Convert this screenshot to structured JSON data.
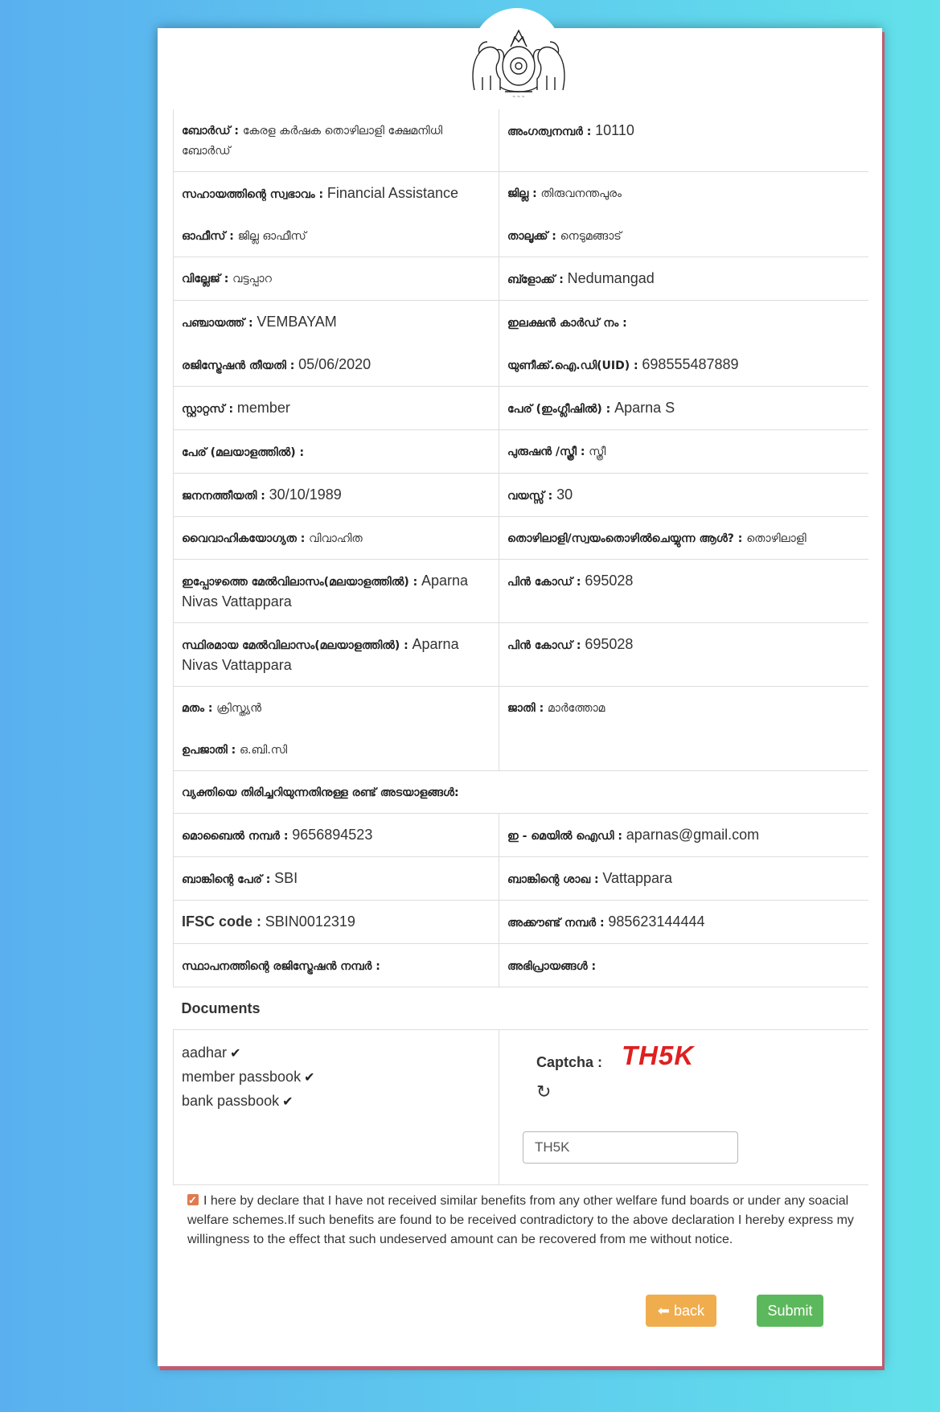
{
  "emblem": "kerala-state-emblem",
  "rows": [
    [
      {
        "label": "ബോർഡ് :",
        "value": "കേരള കർഷക തൊഴിലാളി ക്ഷേമനിധി ബോർഡ്",
        "style": "ml"
      },
      {
        "label": "അംഗത്വനമ്പർ :",
        "value": "10110",
        "style": "en"
      }
    ],
    [
      {
        "label": "സഹായത്തിന്റെ സ്വഭാവം :",
        "value": "Financial Assistance",
        "style": "en"
      },
      {
        "label": "ജില്ല :",
        "value": "തിരുവനന്തപുരം",
        "style": "ml"
      }
    ],
    [
      {
        "label": "ഓഫീസ് :",
        "value": "ജില്ല ഓഫീസ്",
        "style": "ml"
      },
      {
        "label": "താലൂക്ക് :",
        "value": "നെടുമങ്ങാട്",
        "style": "ml"
      }
    ],
    [
      {
        "label": "വില്ലേജ് :",
        "value": "വട്ടപ്പാറ",
        "style": "ml"
      },
      {
        "label": "ബ്ളോക്ക് :",
        "value": "Nedumangad",
        "style": "en"
      }
    ],
    [
      {
        "label": "പഞ്ചായത്ത് :",
        "value": "VEMBAYAM",
        "style": "en"
      },
      {
        "label": "ഇലക്ഷൻ കാർഡ് നം :",
        "value": "",
        "style": "en"
      }
    ],
    [
      {
        "label": "രജിസ്ട്രേഷൻ തീയതി :",
        "value": "05/06/2020",
        "style": "en"
      },
      {
        "label": "യുണീക്ക്.ഐ.ഡി(UID) :",
        "value": "698555487889",
        "style": "en"
      }
    ],
    [
      {
        "label": "സ്റ്റാറ്റസ് :",
        "value": "member",
        "style": "en"
      },
      {
        "label": "പേര് (ഇംഗ്ലീഷിൽ) :",
        "value": "Aparna S",
        "style": "en"
      }
    ],
    [
      {
        "label": "പേര് (മലയാളത്തിൽ) :",
        "value": "",
        "style": "en"
      },
      {
        "label": "പുരുഷൻ /സ്ത്രീ :",
        "value": "സ്ത്രീ",
        "style": "ml"
      }
    ],
    [
      {
        "label": "ജനനത്തീയതി :",
        "value": "30/10/1989",
        "style": "en"
      },
      {
        "label": "വയസ്സ് :",
        "value": "30",
        "style": "en"
      }
    ],
    [
      {
        "label": "വൈവാഹികയോഗ്യത :",
        "value": "വിവാഹിത",
        "style": "ml"
      },
      {
        "label": "തൊഴിലാളി/സ്വയംതൊഴിൽചെയ്യുന്ന ആൾ? :",
        "value": "തൊഴിലാളി",
        "style": "ml"
      }
    ],
    [
      {
        "label": "ഇപ്പോഴത്തെ മേൽവിലാസം(മലയാളത്തിൽ) :",
        "value": "Aparna Nivas Vattappara",
        "style": "en"
      },
      {
        "label": "പിൻ കോഡ് :",
        "value": "695028",
        "style": "en"
      }
    ],
    [
      {
        "label": "സ്ഥിരമായ മേൽവിലാസം(മലയാളത്തിൽ) :",
        "value": "Aparna Nivas Vattappara",
        "style": "en"
      },
      {
        "label": "പിൻ കോഡ് :",
        "value": "695028",
        "style": "en"
      }
    ],
    [
      {
        "label": "മതം :",
        "value": "ക്രിസ്ത്യൻ",
        "style": "ml"
      },
      {
        "label": "ജാതി :",
        "value": "മാർത്തോമ",
        "style": "ml"
      }
    ],
    [
      {
        "label": "ഉപജാതി :",
        "value": "ഒ.ബി.സി",
        "style": "ml"
      },
      {
        "label": "",
        "value": "",
        "style": "en"
      }
    ]
  ],
  "identification_label": "വ്യക്തിയെ തിരിച്ചറിയുന്നതിനുള്ള രണ്ട് അടയാളങ്ങൾ:",
  "rows2": [
    [
      {
        "label": "മൊബൈൽ നമ്പർ :",
        "value": "9656894523",
        "style": "en"
      },
      {
        "label": "ഇ - മെയിൽ ഐഡി :",
        "value": "aparnas@gmail.com",
        "style": "en"
      }
    ],
    [
      {
        "label": "ബാങ്കിന്റെ പേര് :",
        "value": "SBI",
        "style": "en"
      },
      {
        "label": "ബാങ്കിന്റെ ശാഖ :",
        "value": "Vattappara",
        "style": "en"
      }
    ],
    [
      {
        "label": "IFSC code :",
        "value": "SBIN0012319",
        "style": "en"
      },
      {
        "label": "അക്കൗണ്ട് നമ്പർ :",
        "value": "985623144444",
        "style": "en"
      }
    ],
    [
      {
        "label": "സ്ഥാപനത്തിന്റെ രജിസ്ട്രേഷൻ നമ്പർ :",
        "value": "",
        "style": "en"
      },
      {
        "label": "അഭിപ്രായങ്ങൾ :",
        "value": "",
        "style": "en"
      }
    ]
  ],
  "documents": {
    "title": "Documents",
    "items": [
      "aadhar",
      "member passbook",
      "bank passbook"
    ]
  },
  "captcha": {
    "label": "Captcha :",
    "code": "TH5K",
    "input_value": "TH5K"
  },
  "declaration": "I here by declare that I have not received similar benefits from any other welfare fund boards or under any soacial welfare schemes.If such benefits are found to be received contradictory to the above declaration I hereby express my willingness to the effect that such undeserved amount can be recovered from me without notice.",
  "buttons": {
    "back": "back",
    "submit": "Submit"
  },
  "colors": {
    "back": "#f0ad4e",
    "submit": "#5cb85c",
    "captcha": "#e02020",
    "checkbox": "#e07a4f"
  }
}
